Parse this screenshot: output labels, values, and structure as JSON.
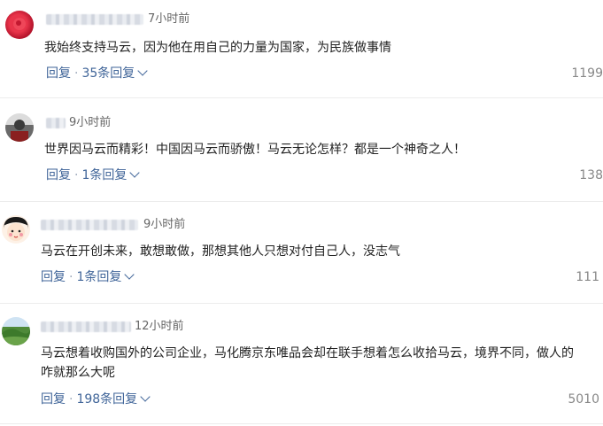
{
  "comments": [
    {
      "time": "7小时前",
      "text": "我始终支持马云，因为他在用自己的力量为国家，为民族做事情",
      "reply_label": "回复",
      "replies_label": "35条回复",
      "likes": "1199"
    },
    {
      "time": "9小时前",
      "text": "世界因马云而精彩！中国因马云而骄傲！马云无论怎样？都是一个神奇之人！",
      "reply_label": "回复",
      "replies_label": "1条回复",
      "likes": "138"
    },
    {
      "time": "9小时前",
      "text": "马云在开创未来，敢想敢做，那想其他人只想对付自己人，没志气",
      "reply_label": "回复",
      "replies_label": "1条回复",
      "likes": "111"
    },
    {
      "time": "12小时前",
      "text_line1": "马云想着收购国外的公司企业，马化腾京东唯品会却在联手想着怎么收拾马云，境界不同，做人的",
      "text_line2": "咋就那么大呢",
      "reply_label": "回复",
      "replies_label": "198条回复",
      "likes": "5010"
    }
  ],
  "colors": {
    "link": "#406599",
    "muted": "#888888",
    "text": "#222222"
  }
}
